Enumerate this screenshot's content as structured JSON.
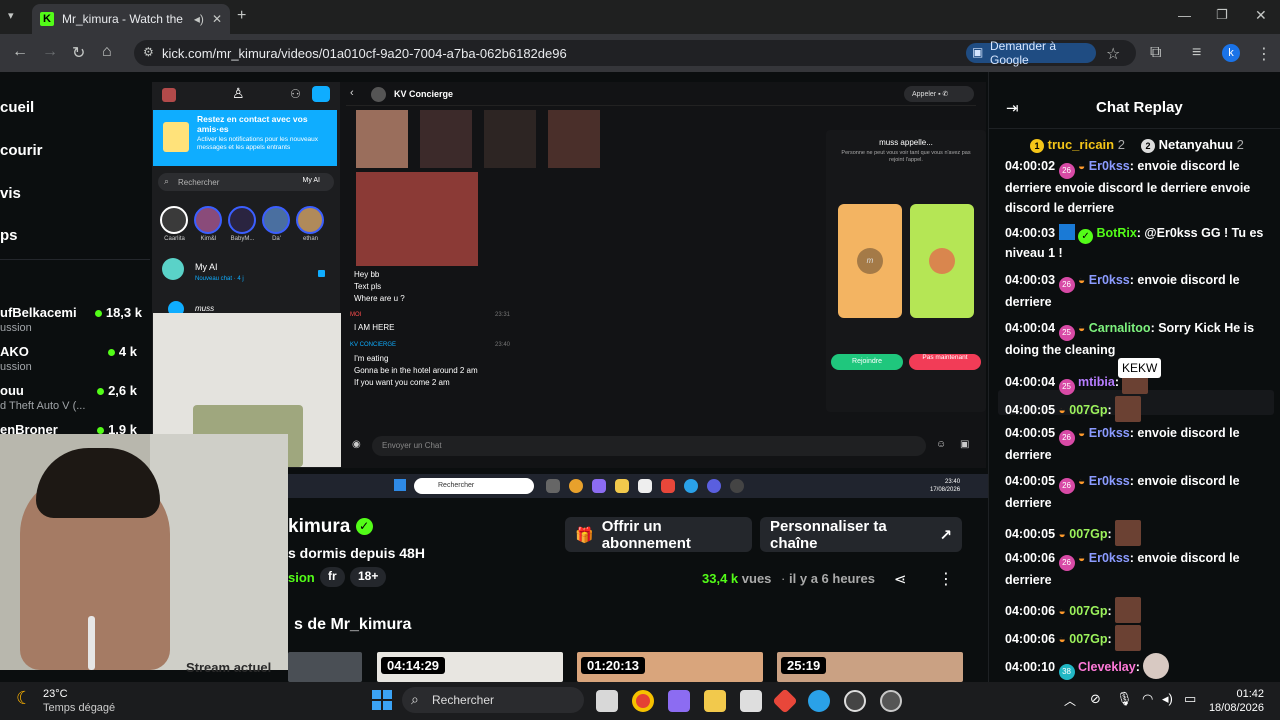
{
  "browser": {
    "tab_title": "Mr_kimura - Watch the VOD",
    "url": "kick.com/mr_kimura/videos/01a010cf-9a20-7004-a7ba-062b6182de96",
    "google_button": "Demander à Google",
    "profile_letter": "k"
  },
  "sidebar": {
    "nav": [
      "cueil",
      "courir",
      "vis",
      "ps"
    ],
    "channels": [
      {
        "name": "ufBelkacemi",
        "sub": "ussion",
        "viewers": "18,3 k"
      },
      {
        "name": "AKO",
        "sub": "ussion",
        "viewers": "4 k"
      },
      {
        "name": "ouu",
        "sub": "d Theft Auto V (...",
        "viewers": "2,6 k"
      },
      {
        "name": "enBroner",
        "sub": "",
        "viewers": "1,9 k"
      }
    ]
  },
  "video": {
    "snap_banner_title": "Restez en contact avec vos amis·es",
    "snap_banner_body": "Activer les notifications pour les nouveaux messages et les appels entrants",
    "snap_search": "Rechercher",
    "snap_myai": "My AI",
    "stories": [
      "Caarlita",
      "Kim&I",
      "BabyM...",
      "Da'",
      "ethan"
    ],
    "ai_name": "My AI",
    "ai_sub": "Nouveau chat · 4 j",
    "muss": "muss",
    "conv_name": "KV Concierge",
    "call_btn": "Appeler",
    "messages": [
      "Hey bb",
      "Text pls",
      "Where are u ?"
    ],
    "moi_label": "MOI",
    "moi_time": "23:31",
    "moi_msg": "I AM HERE",
    "kv_label": "KV CONCIERGE",
    "kv_time": "23:40",
    "kv_msgs": [
      "I'm eating",
      "Gonna be in the hotel around 2 am",
      "If you want you come 2 am"
    ],
    "calling_title": "muss appelle...",
    "calling_sub": "Personne ne peut vous voir tant que vous n'avez pas rejoint l'appel.",
    "join": "Rejoindre",
    "not_now": "Pas maintenant",
    "input_placeholder": "Envoyer un Chat",
    "inner_taskbar_search": "Rechercher",
    "inner_time": "23:40",
    "inner_date": "17/08/2026",
    "avatar_letter": "m"
  },
  "channel": {
    "name": "kimura",
    "title": "s dormis depuis 48H",
    "category": "sion",
    "lang": "fr",
    "age": "18+",
    "gift_btn": "Offrir un abonnement",
    "custom_btn": "Personnaliser ta chaîne",
    "views_num": "33,4 k",
    "views_label": "vues",
    "ago": "il y a 6 heures",
    "more_title": "s de Mr_kimura",
    "thumbs": [
      "04:14:29",
      "01:20:13",
      "25:19"
    ],
    "overlay_text": "Stream actuel"
  },
  "chat": {
    "title": "Chat Replay",
    "top1": {
      "rank": "1",
      "name": "truc_ricain",
      "count": "2"
    },
    "top2": {
      "rank": "2",
      "name": "Netanyahuu",
      "count": "2"
    },
    "tooltip": "KEKW",
    "messages": [
      {
        "time": "04:00:02",
        "badge": "26",
        "user": "Er0kss",
        "color": "#8b9bff",
        "text": "envoie discord le derriere envoie discord le derriere envoie discord le derriere"
      },
      {
        "time": "04:00:03",
        "badge": "",
        "user": "BotRix",
        "color": "#53fc18",
        "text": "@Er0kss GG ! Tu es niveau 1 !"
      },
      {
        "time": "04:00:03",
        "badge": "26",
        "user": "Er0kss",
        "color": "#8b9bff",
        "text": "envoie discord le derriere"
      },
      {
        "time": "04:00:04",
        "badge": "25",
        "user": "Carnalitoo",
        "color": "#7ef27e",
        "text": "Sorry Kick He is doing the cleaning"
      },
      {
        "time": "04:00:04",
        "badge": "25",
        "user": "mtibia",
        "color": "#b77dff",
        "text": ""
      },
      {
        "time": "04:00:05",
        "badge": "",
        "user": "007Gp",
        "color": "#9cf25c",
        "text": ""
      },
      {
        "time": "04:00:05",
        "badge": "26",
        "user": "Er0kss",
        "color": "#8b9bff",
        "text": "envoie discord le derriere"
      },
      {
        "time": "04:00:05",
        "badge": "26",
        "user": "Er0kss",
        "color": "#8b9bff",
        "text": "envoie discord le derriere"
      },
      {
        "time": "04:00:05",
        "badge": "",
        "user": "007Gp",
        "color": "#9cf25c",
        "text": ""
      },
      {
        "time": "04:00:06",
        "badge": "26",
        "user": "Er0kss",
        "color": "#8b9bff",
        "text": "envoie discord le derriere"
      },
      {
        "time": "04:00:06",
        "badge": "",
        "user": "007Gp",
        "color": "#9cf25c",
        "text": ""
      },
      {
        "time": "04:00:06",
        "badge": "",
        "user": "007Gp",
        "color": "#9cf25c",
        "text": ""
      },
      {
        "time": "04:00:10",
        "badge": "38",
        "user": "Cleveklay",
        "color": "#ff7ad9",
        "text": ""
      }
    ]
  },
  "taskbar": {
    "temp": "23°C",
    "weather": "Temps dégagé",
    "search": "Rechercher",
    "time": "01:42",
    "date": "18/08/2026"
  }
}
